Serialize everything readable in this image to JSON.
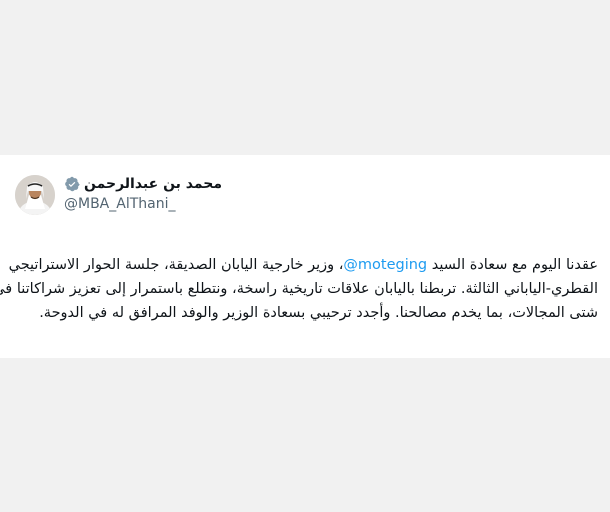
{
  "tweet": {
    "author": {
      "display_name": "محمد بن عبدالرحمن",
      "handle": "@MBA_AlThani_",
      "verified_icon": "verified-gray-badge",
      "verified_color": "#829aab",
      "avatar_icon": "profile-photo"
    },
    "text": {
      "line1_before": "عقدنا اليوم مع سعادة السيد ",
      "mention": "@moteging",
      "line1_after": "، وزير خارجية اليابان الصديقة، جلسة الحوار الاستراتيجي",
      "line2": "القطري-الياباني الثالثة. تربطنا باليابان علاقات تاريخية راسخة، ونتطلع باستمرار إلى تعزيز شراكاتنا في",
      "line3": "شتى المجالات، بما يخدم مصالحنا. وأجدد ترحيبي بسعادة الوزير والوفد المرافق له في الدوحة."
    },
    "colors": {
      "mention": "#1d9bf0",
      "text": "#0f1419",
      "handle": "#536471",
      "background": "#f1f1f1",
      "card": "#ffffff"
    }
  }
}
